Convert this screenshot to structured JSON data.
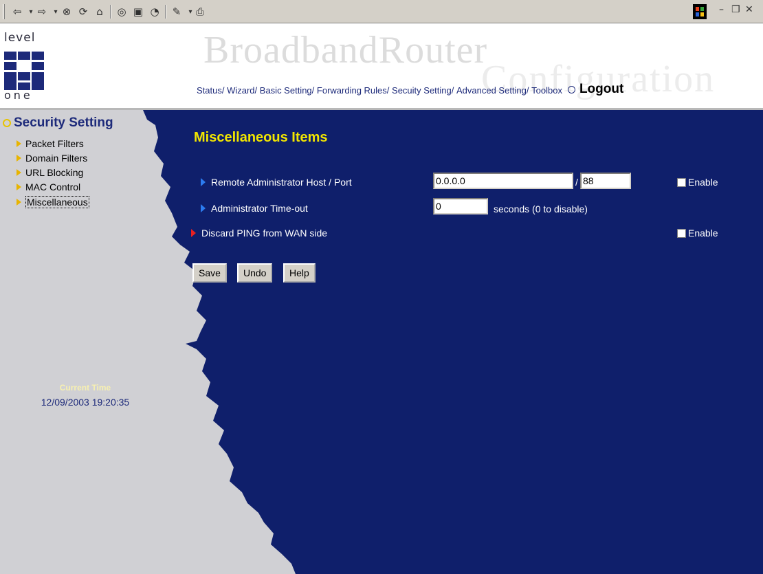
{
  "toolbar": {
    "icons": [
      "back-icon",
      "forward-icon",
      "stop-icon",
      "refresh-icon",
      "home-icon",
      "search-icon",
      "favorites-icon",
      "history-icon",
      "edit-icon",
      "print-icon"
    ],
    "window_controls": [
      "minimize-icon",
      "restore-icon",
      "close-icon"
    ]
  },
  "header": {
    "logo_top": "level",
    "logo_bottom": "one",
    "brand_title": "BroadbandRouter",
    "brand_subtitle": "Configuration",
    "nav": [
      "Status/",
      "Wizard/",
      "Basic Setting/",
      "Forwarding Rules/",
      "Secuity Setting/",
      "Advanced Setting/",
      "Toolbox"
    ],
    "logout_label": "Logout"
  },
  "sidebar": {
    "heading": "Security Setting",
    "items": [
      {
        "label": "Packet Filters"
      },
      {
        "label": "Domain Filters"
      },
      {
        "label": "URL Blocking"
      },
      {
        "label": "MAC Control"
      },
      {
        "label": "Miscellaneous",
        "active": true
      }
    ],
    "time_label": "Current Time",
    "time_value": "12/09/2003 19:20:35"
  },
  "main": {
    "title": "Miscellaneous Items",
    "rows": {
      "remote_admin": {
        "label": "Remote Administrator Host / Port",
        "host_value": "0.0.0.0",
        "separator": "/",
        "port_value": "88",
        "enable_label": "Enable",
        "enabled": false
      },
      "timeout": {
        "label": "Administrator Time-out",
        "value": "0",
        "suffix": "seconds (0 to disable)"
      },
      "discard_ping": {
        "label": "Discard PING from WAN side",
        "enable_label": "Enable",
        "enabled": false
      }
    },
    "buttons": {
      "save": "Save",
      "undo": "Undo",
      "help": "Help"
    }
  },
  "colors": {
    "background_blue": "#0f1f6b",
    "panel_gray": "#d0d0d4",
    "title_yellow": "#f2e600",
    "row_marker_blue": "#2c7cf0",
    "row_marker_red": "#e82020"
  }
}
